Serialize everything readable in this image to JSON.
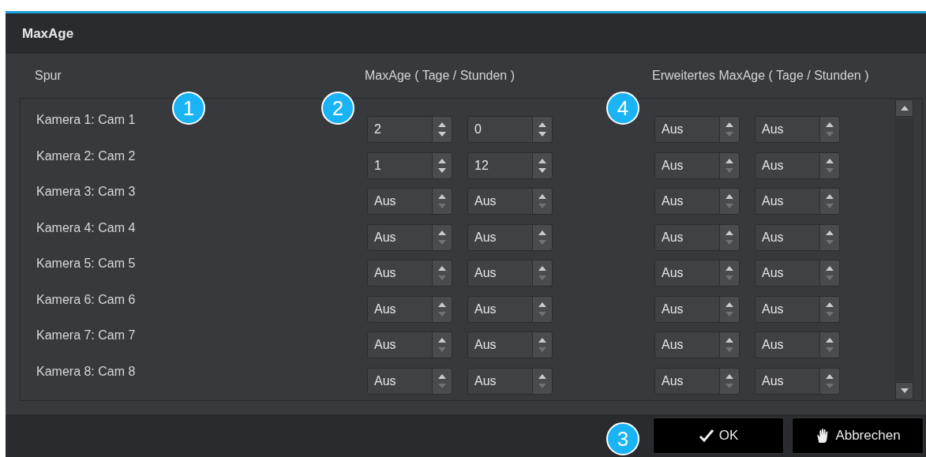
{
  "window": {
    "title": "MaxAge"
  },
  "columns": [
    "Spur",
    "MaxAge ( Tage / Stunden )",
    "Erweitertes MaxAge ( Tage / Stunden )"
  ],
  "rows": [
    {
      "label": "Kamera 1: Cam 1",
      "spinners": [
        {
          "value": "2",
          "down_disabled": false
        },
        {
          "value": "0",
          "down_disabled": false
        },
        {
          "value": "Aus",
          "down_disabled": true
        },
        {
          "value": "Aus",
          "down_disabled": true
        }
      ]
    },
    {
      "label": "Kamera 2: Cam 2",
      "spinners": [
        {
          "value": "1",
          "down_disabled": false
        },
        {
          "value": "12",
          "down_disabled": false
        },
        {
          "value": "Aus",
          "down_disabled": true
        },
        {
          "value": "Aus",
          "down_disabled": true
        }
      ]
    },
    {
      "label": "Kamera 3: Cam 3",
      "spinners": [
        {
          "value": "Aus",
          "down_disabled": true
        },
        {
          "value": "Aus",
          "down_disabled": true
        },
        {
          "value": "Aus",
          "down_disabled": true
        },
        {
          "value": "Aus",
          "down_disabled": true
        }
      ]
    },
    {
      "label": "Kamera 4: Cam 4",
      "spinners": [
        {
          "value": "Aus",
          "down_disabled": true
        },
        {
          "value": "Aus",
          "down_disabled": true
        },
        {
          "value": "Aus",
          "down_disabled": true
        },
        {
          "value": "Aus",
          "down_disabled": true
        }
      ]
    },
    {
      "label": "Kamera 5: Cam 5",
      "spinners": [
        {
          "value": "Aus",
          "down_disabled": true
        },
        {
          "value": "Aus",
          "down_disabled": true
        },
        {
          "value": "Aus",
          "down_disabled": true
        },
        {
          "value": "Aus",
          "down_disabled": true
        }
      ]
    },
    {
      "label": "Kamera 6: Cam 6",
      "spinners": [
        {
          "value": "Aus",
          "down_disabled": true
        },
        {
          "value": "Aus",
          "down_disabled": true
        },
        {
          "value": "Aus",
          "down_disabled": true
        },
        {
          "value": "Aus",
          "down_disabled": true
        }
      ]
    },
    {
      "label": "Kamera 7: Cam 7",
      "spinners": [
        {
          "value": "Aus",
          "down_disabled": true
        },
        {
          "value": "Aus",
          "down_disabled": true
        },
        {
          "value": "Aus",
          "down_disabled": true
        },
        {
          "value": "Aus",
          "down_disabled": true
        }
      ]
    },
    {
      "label": "Kamera 8: Cam 8",
      "spinners": [
        {
          "value": "Aus",
          "down_disabled": true
        },
        {
          "value": "Aus",
          "down_disabled": true
        },
        {
          "value": "Aus",
          "down_disabled": true
        },
        {
          "value": "Aus",
          "down_disabled": true
        }
      ]
    }
  ],
  "buttons": [
    {
      "kind": "ok",
      "label": "OK"
    },
    {
      "kind": "cancel",
      "label": "Abbrechen"
    }
  ],
  "callouts": [
    "1",
    "2",
    "4",
    "3"
  ]
}
